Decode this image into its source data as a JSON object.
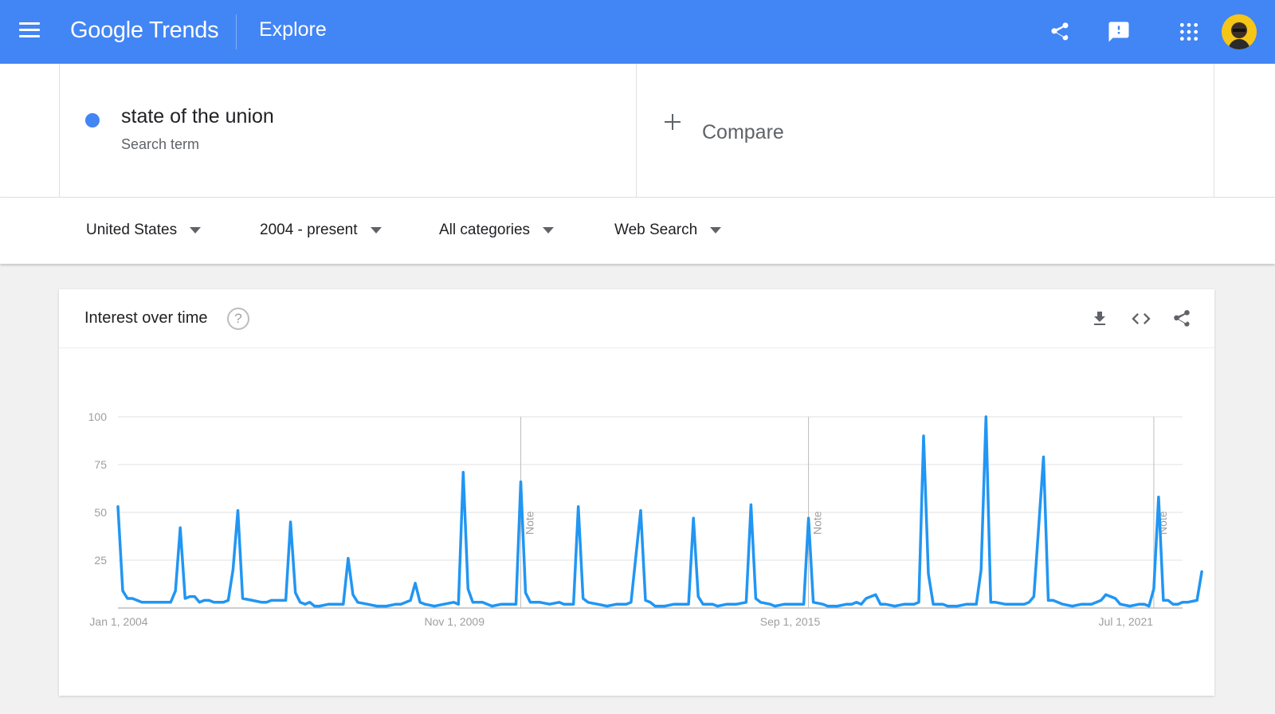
{
  "header": {
    "logo_google": "Google",
    "logo_trends": "Trends",
    "page_title": "Explore",
    "icons": [
      "menu-icon",
      "share-icon",
      "feedback-icon",
      "apps-grid-icon",
      "account-avatar"
    ],
    "color": "#4285f4"
  },
  "search_term": {
    "name": "state of the union",
    "type": "Search term",
    "color": "#4285f4"
  },
  "compare": {
    "label": "Compare"
  },
  "filters": {
    "region": "United States",
    "time_range": "2004 - present",
    "category": "All categories",
    "property": "Web Search"
  },
  "interest_card": {
    "title": "Interest over time",
    "help": "?",
    "icons": [
      "download-icon",
      "embed-code-icon",
      "share-icon"
    ]
  },
  "chart_data": {
    "type": "line",
    "title": "Interest over time",
    "xlabel": "",
    "ylabel": "",
    "ylim": [
      0,
      100
    ],
    "yticks": [
      100,
      75,
      50,
      25
    ],
    "x_range": [
      "2004-01",
      "2022-07"
    ],
    "xtick_labels": [
      {
        "date": "2004-01",
        "label": "Jan 1, 2004"
      },
      {
        "date": "2009-11",
        "label": "Nov 1, 2009"
      },
      {
        "date": "2015-09",
        "label": "Sep 1, 2015"
      },
      {
        "date": "2021-07",
        "label": "Jul 1, 2021"
      }
    ],
    "notes": [
      {
        "date": "2011-01",
        "label": "Note"
      },
      {
        "date": "2016-01",
        "label": "Note"
      },
      {
        "date": "2022-01",
        "label": "Note"
      }
    ],
    "grid": true,
    "series": [
      {
        "name": "state of the union",
        "color": "#2196f3",
        "points": [
          [
            "2004-01",
            53
          ],
          [
            "2004-02",
            9
          ],
          [
            "2004-03",
            5
          ],
          [
            "2004-04",
            5
          ],
          [
            "2004-05",
            4
          ],
          [
            "2004-06",
            3
          ],
          [
            "2004-08",
            3
          ],
          [
            "2004-10",
            3
          ],
          [
            "2004-12",
            3
          ],
          [
            "2005-01",
            9
          ],
          [
            "2005-02",
            42
          ],
          [
            "2005-03",
            5
          ],
          [
            "2005-04",
            6
          ],
          [
            "2005-05",
            6
          ],
          [
            "2005-06",
            3
          ],
          [
            "2005-07",
            4
          ],
          [
            "2005-08",
            4
          ],
          [
            "2005-09",
            3
          ],
          [
            "2005-10",
            3
          ],
          [
            "2005-11",
            3
          ],
          [
            "2005-12",
            4
          ],
          [
            "2006-01",
            20
          ],
          [
            "2006-02",
            51
          ],
          [
            "2006-03",
            5
          ],
          [
            "2006-05",
            4
          ],
          [
            "2006-07",
            3
          ],
          [
            "2006-08",
            3
          ],
          [
            "2006-09",
            4
          ],
          [
            "2006-11",
            4
          ],
          [
            "2006-12",
            4
          ],
          [
            "2007-01",
            45
          ],
          [
            "2007-02",
            8
          ],
          [
            "2007-03",
            3
          ],
          [
            "2007-04",
            2
          ],
          [
            "2007-05",
            3
          ],
          [
            "2007-06",
            1
          ],
          [
            "2007-07",
            1
          ],
          [
            "2007-09",
            2
          ],
          [
            "2007-11",
            2
          ],
          [
            "2007-12",
            2
          ],
          [
            "2008-01",
            26
          ],
          [
            "2008-02",
            7
          ],
          [
            "2008-03",
            3
          ],
          [
            "2008-05",
            2
          ],
          [
            "2008-07",
            1
          ],
          [
            "2008-09",
            1
          ],
          [
            "2008-11",
            2
          ],
          [
            "2008-12",
            2
          ],
          [
            "2009-02",
            4
          ],
          [
            "2009-03",
            13
          ],
          [
            "2009-04",
            3
          ],
          [
            "2009-05",
            2
          ],
          [
            "2009-07",
            1
          ],
          [
            "2009-09",
            2
          ],
          [
            "2009-11",
            3
          ],
          [
            "2009-12",
            2
          ],
          [
            "2010-01",
            71
          ],
          [
            "2010-02",
            10
          ],
          [
            "2010-03",
            3
          ],
          [
            "2010-05",
            3
          ],
          [
            "2010-07",
            1
          ],
          [
            "2010-09",
            2
          ],
          [
            "2010-11",
            2
          ],
          [
            "2010-12",
            2
          ],
          [
            "2011-01",
            66
          ],
          [
            "2011-02",
            8
          ],
          [
            "2011-03",
            3
          ],
          [
            "2011-05",
            3
          ],
          [
            "2011-07",
            2
          ],
          [
            "2011-09",
            3
          ],
          [
            "2011-10",
            2
          ],
          [
            "2011-12",
            2
          ],
          [
            "2012-01",
            53
          ],
          [
            "2012-02",
            5
          ],
          [
            "2012-03",
            3
          ],
          [
            "2012-05",
            2
          ],
          [
            "2012-07",
            1
          ],
          [
            "2012-09",
            2
          ],
          [
            "2012-11",
            2
          ],
          [
            "2012-12",
            3
          ],
          [
            "2013-02",
            51
          ],
          [
            "2013-03",
            4
          ],
          [
            "2013-04",
            3
          ],
          [
            "2013-05",
            1
          ],
          [
            "2013-07",
            1
          ],
          [
            "2013-09",
            2
          ],
          [
            "2013-11",
            2
          ],
          [
            "2013-12",
            2
          ],
          [
            "2014-01",
            47
          ],
          [
            "2014-02",
            6
          ],
          [
            "2014-03",
            2
          ],
          [
            "2014-05",
            2
          ],
          [
            "2014-06",
            1
          ],
          [
            "2014-08",
            2
          ],
          [
            "2014-10",
            2
          ],
          [
            "2014-12",
            3
          ],
          [
            "2015-01",
            54
          ],
          [
            "2015-02",
            5
          ],
          [
            "2015-03",
            3
          ],
          [
            "2015-05",
            2
          ],
          [
            "2015-06",
            1
          ],
          [
            "2015-08",
            2
          ],
          [
            "2015-10",
            2
          ],
          [
            "2015-12",
            2
          ],
          [
            "2016-01",
            47
          ],
          [
            "2016-02",
            3
          ],
          [
            "2016-04",
            2
          ],
          [
            "2016-05",
            1
          ],
          [
            "2016-07",
            1
          ],
          [
            "2016-09",
            2
          ],
          [
            "2016-10",
            2
          ],
          [
            "2016-11",
            3
          ],
          [
            "2016-12",
            2
          ],
          [
            "2017-01",
            5
          ],
          [
            "2017-02",
            6
          ],
          [
            "2017-03",
            7
          ],
          [
            "2017-04",
            2
          ],
          [
            "2017-05",
            2
          ],
          [
            "2017-07",
            1
          ],
          [
            "2017-09",
            2
          ],
          [
            "2017-11",
            2
          ],
          [
            "2017-12",
            3
          ],
          [
            "2018-01",
            90
          ],
          [
            "2018-02",
            18
          ],
          [
            "2018-03",
            2
          ],
          [
            "2018-05",
            2
          ],
          [
            "2018-06",
            1
          ],
          [
            "2018-08",
            1
          ],
          [
            "2018-10",
            2
          ],
          [
            "2018-12",
            2
          ],
          [
            "2019-01",
            20
          ],
          [
            "2019-02",
            100
          ],
          [
            "2019-03",
            3
          ],
          [
            "2019-04",
            3
          ],
          [
            "2019-06",
            2
          ],
          [
            "2019-08",
            2
          ],
          [
            "2019-10",
            2
          ],
          [
            "2019-11",
            3
          ],
          [
            "2019-12",
            6
          ],
          [
            "2020-02",
            79
          ],
          [
            "2020-03",
            4
          ],
          [
            "2020-04",
            4
          ],
          [
            "2020-05",
            3
          ],
          [
            "2020-06",
            2
          ],
          [
            "2020-08",
            1
          ],
          [
            "2020-10",
            2
          ],
          [
            "2020-12",
            2
          ],
          [
            "2021-02",
            4
          ],
          [
            "2021-03",
            7
          ],
          [
            "2021-04",
            6
          ],
          [
            "2021-05",
            5
          ],
          [
            "2021-06",
            2
          ],
          [
            "2021-08",
            1
          ],
          [
            "2021-10",
            2
          ],
          [
            "2021-11",
            2
          ],
          [
            "2021-12",
            1
          ],
          [
            "2022-01",
            10
          ],
          [
            "2022-02",
            58
          ],
          [
            "2022-03",
            4
          ],
          [
            "2022-04",
            4
          ],
          [
            "2022-05",
            2
          ],
          [
            "2022-06",
            2
          ],
          [
            "2022-07",
            3
          ],
          [
            "2022-08",
            3
          ],
          [
            "2022-10",
            4
          ],
          [
            "2022-11",
            19
          ]
        ]
      }
    ]
  }
}
